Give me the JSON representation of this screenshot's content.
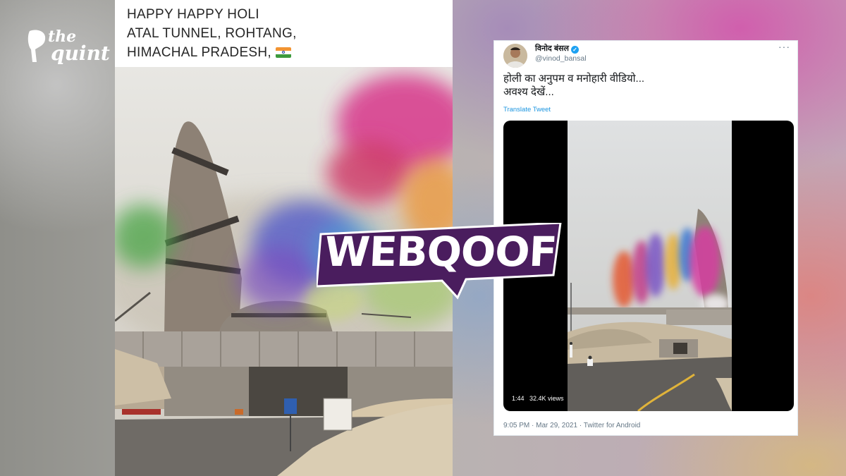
{
  "logo": {
    "line1": "the",
    "line2": "quint"
  },
  "left_post": {
    "caption_lines": [
      "HAPPY HAPPY HOLI",
      "ATAL TUNNEL, ROHTANG,",
      "HIMACHAL PRADESH,"
    ],
    "flag_icon": "india-flag-icon"
  },
  "badge": {
    "label": "WEBQOOF",
    "color": "#4a1d5e"
  },
  "tweet": {
    "display_name": "विनोद बंसल",
    "handle": "@vinod_bansal",
    "text_lines": [
      "होली का अनुपम व मनोहारी वीडियो...",
      "अवश्य देखें..."
    ],
    "translate_label": "Translate Tweet",
    "video": {
      "duration": "1:44",
      "views": "32.4K views"
    },
    "footer": "9:05 PM · Mar 29, 2021 · Twitter for Android",
    "icons": {
      "verified": "verified-badge-icon",
      "more": "more-options-icon"
    },
    "link_color": "#1b95e0"
  }
}
